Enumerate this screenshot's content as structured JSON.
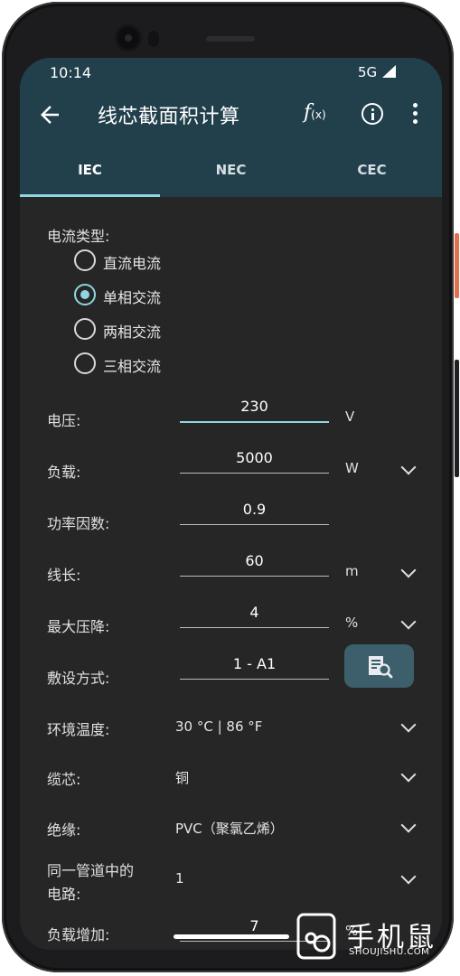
{
  "status": {
    "time": "10:14",
    "network": "5G"
  },
  "appbar": {
    "title": "线芯截面积计算",
    "fx_label": "f",
    "fx_sub": "(x)"
  },
  "tabs": [
    {
      "label": "IEC",
      "active": true
    },
    {
      "label": "NEC",
      "active": false
    },
    {
      "label": "CEC",
      "active": false
    }
  ],
  "current_type": {
    "label": "电流类型:",
    "options": [
      {
        "label": "直流电流",
        "checked": false
      },
      {
        "label": "单相交流",
        "checked": true
      },
      {
        "label": "两相交流",
        "checked": false
      },
      {
        "label": "三相交流",
        "checked": false
      }
    ]
  },
  "fields": {
    "voltage": {
      "label": "电压:",
      "value": "230",
      "unit": "V"
    },
    "load": {
      "label": "负载:",
      "value": "5000",
      "unit": "W"
    },
    "power_factor": {
      "label": "功率因数:",
      "value": "0.9"
    },
    "length": {
      "label": "线长:",
      "value": "60",
      "unit": "m"
    },
    "max_drop": {
      "label": "最大压降:",
      "value": "4",
      "unit": "%"
    },
    "install_method": {
      "label": "敷设方式:",
      "value": "1 - A1"
    },
    "ambient_temp": {
      "label": "环境温度:",
      "value": "30 °C | 86 °F"
    },
    "conductor": {
      "label": "缆芯:",
      "value": "铜"
    },
    "insulation": {
      "label": "绝缘:",
      "value": "PVC（聚氯乙烯）"
    },
    "circuits": {
      "label_line1": "同一管道中的",
      "label_line2": "电路:",
      "value": "1"
    },
    "load_increase": {
      "label": "负载增加:",
      "value": "7",
      "unit": "%"
    }
  },
  "watermark": {
    "text": "手机鼠",
    "sub": "SHOUJISHU.COM"
  },
  "colors": {
    "appbar": "#22404c",
    "accent": "#8fd6e1",
    "background": "#262626",
    "button": "#3d5f6c"
  }
}
